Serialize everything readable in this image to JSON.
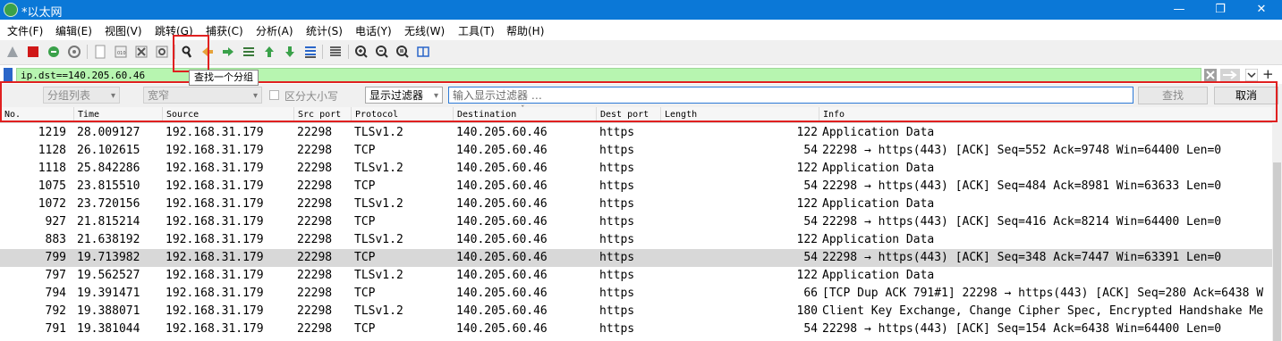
{
  "window": {
    "title": "*以太网",
    "min": "—",
    "restore": "❐",
    "close": "✕"
  },
  "menu": [
    "文件(F)",
    "编辑(E)",
    "视图(V)",
    "跳转(G)",
    "捕获(C)",
    "分析(A)",
    "统计(S)",
    "电话(Y)",
    "无线(W)",
    "工具(T)",
    "帮助(H)"
  ],
  "tooltip": "查找一个分组",
  "filter": {
    "value": "ip.dst==140.205.60.46"
  },
  "find": {
    "scope": "分组列表",
    "charset": "宽窄",
    "case_label": "区分大小写",
    "type": "显示过滤器",
    "placeholder": "输入显示过滤器 …",
    "find_label": "查找",
    "cancel_label": "取消"
  },
  "columns": [
    "No.",
    "Time",
    "Source",
    "Src port",
    "Protocol",
    "Destination",
    "Dest port",
    "Length",
    "Info"
  ],
  "rows": [
    {
      "no": "1219",
      "time": "28.009127",
      "src": "192.168.31.179",
      "sport": "22298",
      "proto": "TLSv1.2",
      "dst": "140.205.60.46",
      "dport": "https",
      "len": "122",
      "info": "Application Data"
    },
    {
      "no": "1128",
      "time": "26.102615",
      "src": "192.168.31.179",
      "sport": "22298",
      "proto": "TCP",
      "dst": "140.205.60.46",
      "dport": "https",
      "len": "54",
      "info": "22298 → https(443) [ACK] Seq=552 Ack=9748 Win=64400 Len=0"
    },
    {
      "no": "1118",
      "time": "25.842286",
      "src": "192.168.31.179",
      "sport": "22298",
      "proto": "TLSv1.2",
      "dst": "140.205.60.46",
      "dport": "https",
      "len": "122",
      "info": "Application Data"
    },
    {
      "no": "1075",
      "time": "23.815510",
      "src": "192.168.31.179",
      "sport": "22298",
      "proto": "TCP",
      "dst": "140.205.60.46",
      "dport": "https",
      "len": "54",
      "info": "22298 → https(443) [ACK] Seq=484 Ack=8981 Win=63633 Len=0"
    },
    {
      "no": "1072",
      "time": "23.720156",
      "src": "192.168.31.179",
      "sport": "22298",
      "proto": "TLSv1.2",
      "dst": "140.205.60.46",
      "dport": "https",
      "len": "122",
      "info": "Application Data"
    },
    {
      "no": "927",
      "time": "21.815214",
      "src": "192.168.31.179",
      "sport": "22298",
      "proto": "TCP",
      "dst": "140.205.60.46",
      "dport": "https",
      "len": "54",
      "info": "22298 → https(443) [ACK] Seq=416 Ack=8214 Win=64400 Len=0"
    },
    {
      "no": "883",
      "time": "21.638192",
      "src": "192.168.31.179",
      "sport": "22298",
      "proto": "TLSv1.2",
      "dst": "140.205.60.46",
      "dport": "https",
      "len": "122",
      "info": "Application Data"
    },
    {
      "no": "799",
      "time": "19.713982",
      "src": "192.168.31.179",
      "sport": "22298",
      "proto": "TCP",
      "dst": "140.205.60.46",
      "dport": "https",
      "len": "54",
      "info": "22298 → https(443) [ACK] Seq=348 Ack=7447 Win=63391 Len=0",
      "selected": true
    },
    {
      "no": "797",
      "time": "19.562527",
      "src": "192.168.31.179",
      "sport": "22298",
      "proto": "TLSv1.2",
      "dst": "140.205.60.46",
      "dport": "https",
      "len": "122",
      "info": "Application Data"
    },
    {
      "no": "794",
      "time": "19.391471",
      "src": "192.168.31.179",
      "sport": "22298",
      "proto": "TCP",
      "dst": "140.205.60.46",
      "dport": "https",
      "len": "66",
      "info": "[TCP Dup ACK 791#1] 22298 → https(443) [ACK] Seq=280 Ack=6438 W"
    },
    {
      "no": "792",
      "time": "19.388071",
      "src": "192.168.31.179",
      "sport": "22298",
      "proto": "TLSv1.2",
      "dst": "140.205.60.46",
      "dport": "https",
      "len": "180",
      "info": "Client Key Exchange, Change Cipher Spec, Encrypted Handshake Me"
    },
    {
      "no": "791",
      "time": "19.381044",
      "src": "192.168.31.179",
      "sport": "22298",
      "proto": "TCP",
      "dst": "140.205.60.46",
      "dport": "https",
      "len": "54",
      "info": "22298 → https(443) [ACK] Seq=154 Ack=6438 Win=64400 Len=0"
    }
  ]
}
